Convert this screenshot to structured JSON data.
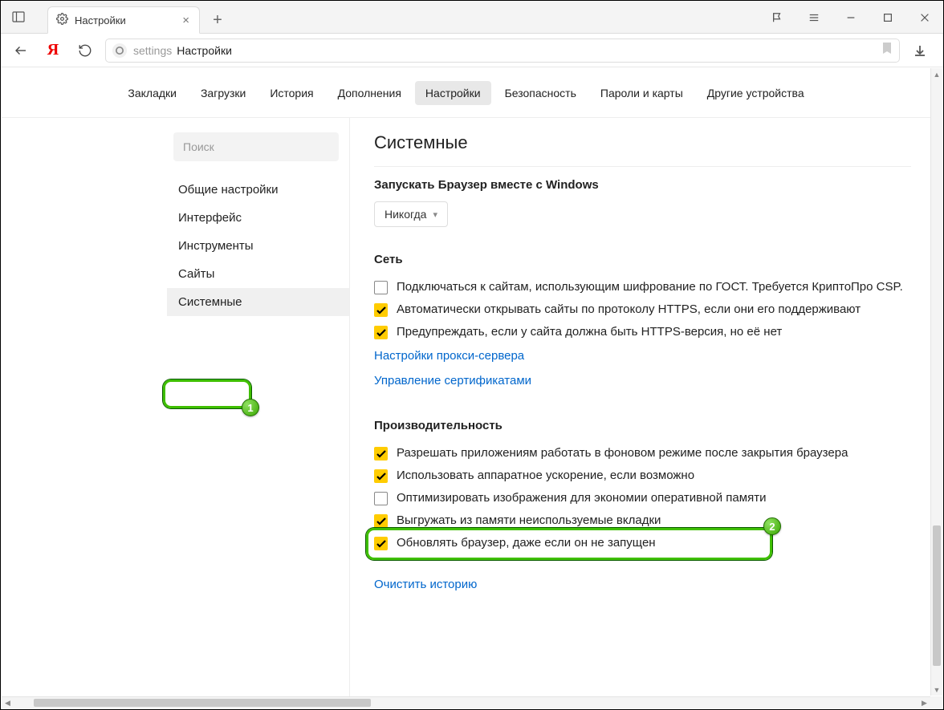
{
  "tab": {
    "title": "Настройки"
  },
  "address": {
    "path": "settings",
    "title": "Настройки"
  },
  "topnav": {
    "items": [
      {
        "label": "Закладки"
      },
      {
        "label": "Загрузки"
      },
      {
        "label": "История"
      },
      {
        "label": "Дополнения"
      },
      {
        "label": "Настройки",
        "active": true
      },
      {
        "label": "Безопасность"
      },
      {
        "label": "Пароли и карты"
      },
      {
        "label": "Другие устройства"
      }
    ]
  },
  "sidebar": {
    "search_placeholder": "Поиск",
    "items": [
      {
        "label": "Общие настройки"
      },
      {
        "label": "Интерфейс"
      },
      {
        "label": "Инструменты"
      },
      {
        "label": "Сайты"
      },
      {
        "label": "Системные",
        "active": true
      }
    ]
  },
  "page": {
    "heading": "Системные",
    "startup": {
      "title": "Запускать Браузер вместе с Windows",
      "value": "Никогда"
    },
    "network": {
      "title": "Сеть",
      "opts": [
        {
          "checked": false,
          "label": "Подключаться к сайтам, использующим шифрование по ГОСТ. Требуется КриптоПро CSP."
        },
        {
          "checked": true,
          "label": "Автоматически открывать сайты по протоколу HTTPS, если они его поддерживают"
        },
        {
          "checked": true,
          "label": "Предупреждать, если у сайта должна быть HTTPS-версия, но её нет"
        }
      ],
      "links": [
        "Настройки прокси-сервера",
        "Управление сертификатами"
      ]
    },
    "perf": {
      "title": "Производительность",
      "opts": [
        {
          "checked": true,
          "label": "Разрешать приложениям работать в фоновом режиме после закрытия браузера"
        },
        {
          "checked": true,
          "label": "Использовать аппаратное ускорение, если возможно"
        },
        {
          "checked": false,
          "label": "Оптимизировать изображения для экономии оперативной памяти"
        },
        {
          "checked": true,
          "label": "Выгружать из памяти неиспользуемые вкладки"
        },
        {
          "checked": true,
          "label": "Обновлять браузер, даже если он не запущен"
        }
      ],
      "clear_link": "Очистить историю"
    }
  },
  "annotations": {
    "b1": "1",
    "b2": "2"
  }
}
